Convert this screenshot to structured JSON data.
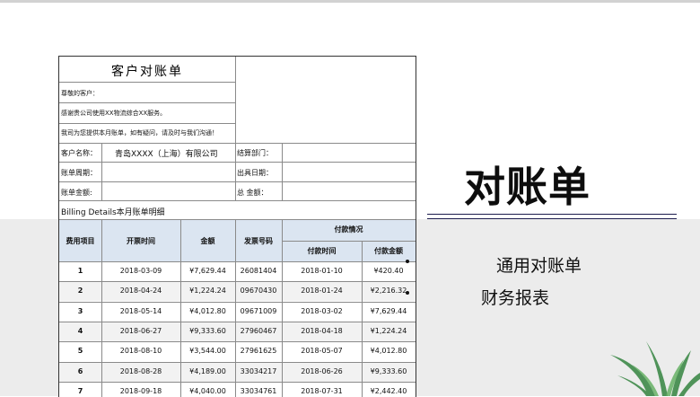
{
  "sheet": {
    "title": "客户对账单",
    "greeting": "尊敬的客户：",
    "thanks": "感谢贵公司使用XX物流综合XX服务。",
    "notice": "我司为您提供本月账单，如有疑问，请及时与我们沟通！",
    "customer_label": "客户名称：",
    "customer_value": "青岛XXXX（上海）有限公司",
    "dept_label": "结算部门：",
    "period_label": "账单周期：",
    "issue_label": "出具日期：",
    "amount_label": "账单金额:",
    "total_label": "总  金额：",
    "billing_caption": "Billing Details本月账单明细",
    "columns": {
      "item": "费用项目",
      "invoice_time": "开票时间",
      "amount": "金额",
      "invoice_no": "发票号码",
      "payment_group": "付款情况",
      "pay_time": "付款时间",
      "pay_amount": "付款金额"
    },
    "rows": [
      [
        "1",
        "2018-03-09",
        "¥7,629.44",
        "26081404",
        "2018-01-10",
        "¥420.40"
      ],
      [
        "2",
        "2018-04-24",
        "¥1,224.24",
        "09670430",
        "2018-01-24",
        "¥2,216.32"
      ],
      [
        "3",
        "2018-05-14",
        "¥4,012.80",
        "09671009",
        "2018-03-02",
        "¥7,629.44"
      ],
      [
        "4",
        "2018-06-27",
        "¥9,333.60",
        "27960467",
        "2018-04-18",
        "¥1,224.24"
      ],
      [
        "5",
        "2018-08-10",
        "¥3,544.00",
        "27961625",
        "2018-05-07",
        "¥4,012.80"
      ],
      [
        "6",
        "2018-08-28",
        "¥4,189.00",
        "33034217",
        "2018-06-26",
        "¥9,333.60"
      ],
      [
        "7",
        "2018-09-18",
        "¥4,040.00",
        "33034761",
        "2018-07-31",
        "¥2,442.40"
      ]
    ]
  },
  "right": {
    "big_title": "对账单",
    "subtitle1": "通用对账单",
    "subtitle2": "财务报表"
  },
  "colors": {
    "header_fill": "#dbe5f1",
    "alt_row_fill": "#f2f2f2",
    "band": "#ececec",
    "rule": "#1c1c4e"
  }
}
